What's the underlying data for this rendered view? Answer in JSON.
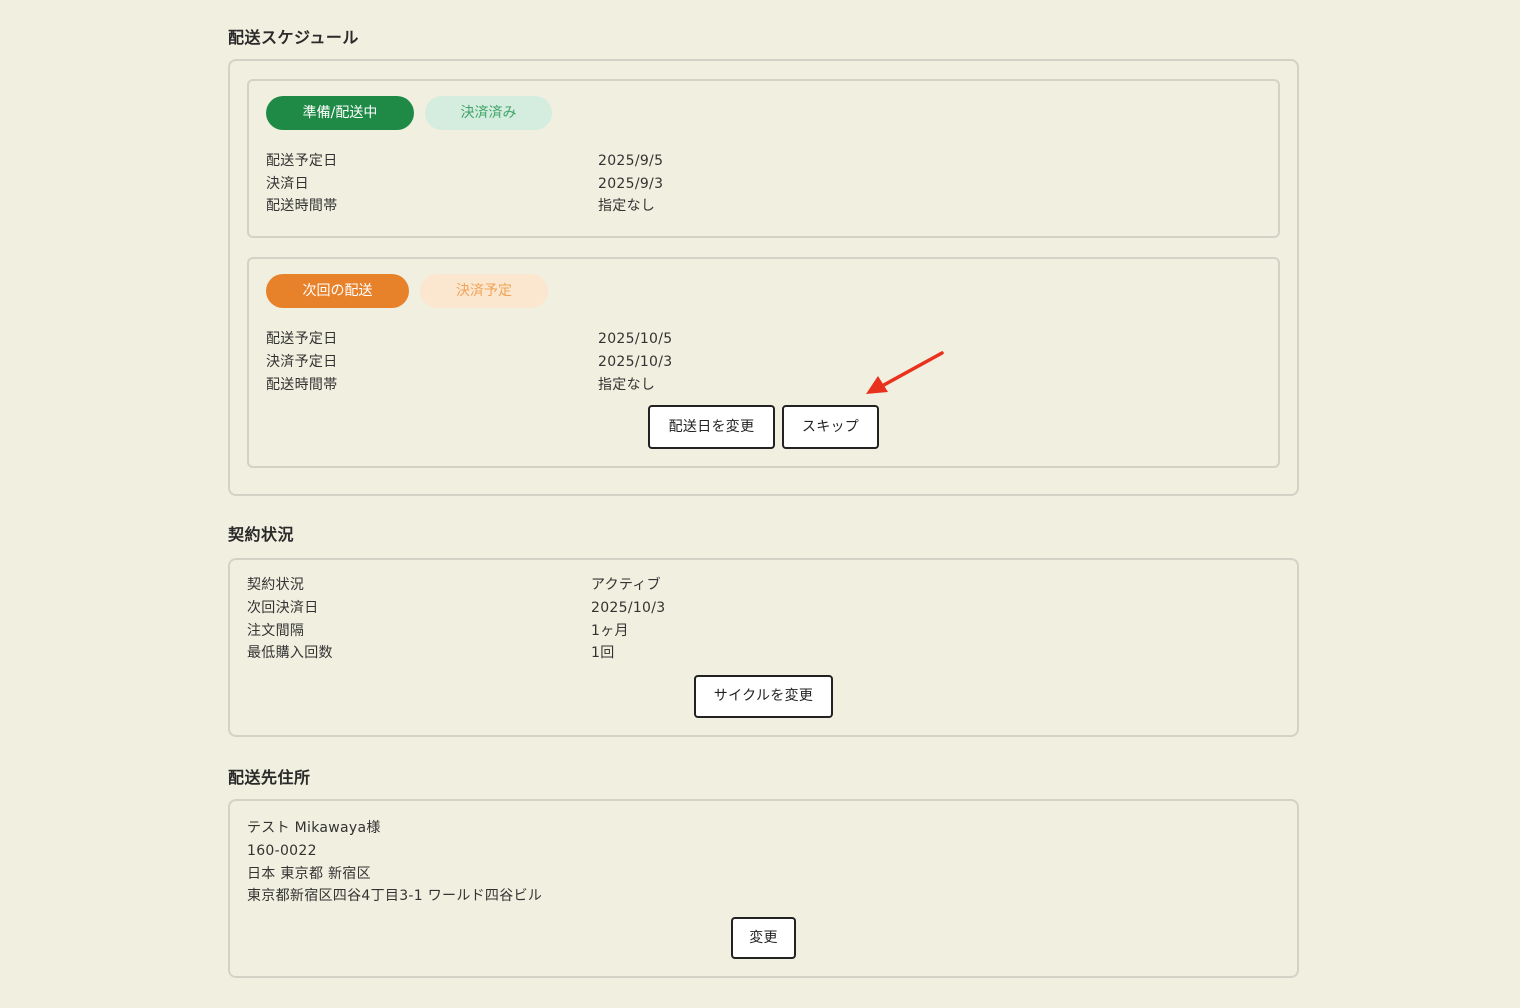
{
  "delivery_schedule": {
    "title": "配送スケジュール",
    "current": {
      "status_badge": "準備/配送中",
      "payment_badge": "決済済み",
      "rows": [
        {
          "label": "配送予定日",
          "value": "2025/9/5"
        },
        {
          "label": "決済日",
          "value": "2025/9/3"
        },
        {
          "label": "配送時間帯",
          "value": "指定なし"
        }
      ]
    },
    "next": {
      "status_badge": "次回の配送",
      "payment_badge": "決済予定",
      "rows": [
        {
          "label": "配送予定日",
          "value": "2025/10/5"
        },
        {
          "label": "決済予定日",
          "value": "2025/10/3"
        },
        {
          "label": "配送時間帯",
          "value": "指定なし"
        }
      ],
      "change_date_button": "配送日を変更",
      "skip_button": "スキップ"
    }
  },
  "contract": {
    "title": "契約状況",
    "rows": [
      {
        "label": "契約状況",
        "value": "アクティブ"
      },
      {
        "label": "次回決済日",
        "value": "2025/10/3"
      },
      {
        "label": "注文間隔",
        "value": "1ヶ月"
      },
      {
        "label": "最低購入回数",
        "value": "1回"
      }
    ],
    "change_cycle_button": "サイクルを変更"
  },
  "address": {
    "title": "配送先住所",
    "lines": [
      "テスト Mikawaya様",
      "160-0022",
      "日本 東京都 新宿区",
      "東京都新宿区四谷4丁目3-1 ワールド四谷ビル"
    ],
    "change_button": "変更"
  },
  "colors": {
    "background": "#f1efdf",
    "green": "#1e8a45",
    "green_light": "#d4edde",
    "orange": "#e8822a",
    "orange_light": "#fbe6cf",
    "annotation_arrow": "#e8321e"
  }
}
